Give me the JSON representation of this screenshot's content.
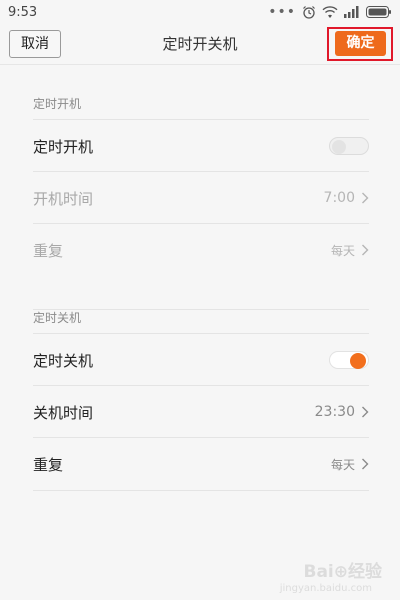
{
  "status_bar": {
    "time": "9:53",
    "dots": "•••",
    "icons": [
      "alarm-icon",
      "wifi-icon",
      "signal-icon",
      "battery-icon"
    ]
  },
  "header": {
    "cancel_label": "取消",
    "title": "定时开关机",
    "confirm_label": "确定",
    "confirm_color": "#ee6a1c",
    "highlight_color": "#e0182a"
  },
  "power_on": {
    "section_title": "定时开机",
    "toggle_label": "定时开机",
    "toggle_on": false,
    "time_label": "开机时间",
    "time_value": "7:00",
    "repeat_label": "重复",
    "repeat_value": "每天"
  },
  "power_off": {
    "section_title": "定时关机",
    "toggle_label": "定时关机",
    "toggle_on": true,
    "toggle_color": "#f26f1d",
    "time_label": "关机时间",
    "time_value": "23:30",
    "repeat_label": "重复",
    "repeat_value": "每天"
  },
  "watermark": {
    "text": "Bai⊕经验",
    "subtext": "jingyan.baidu.com"
  }
}
